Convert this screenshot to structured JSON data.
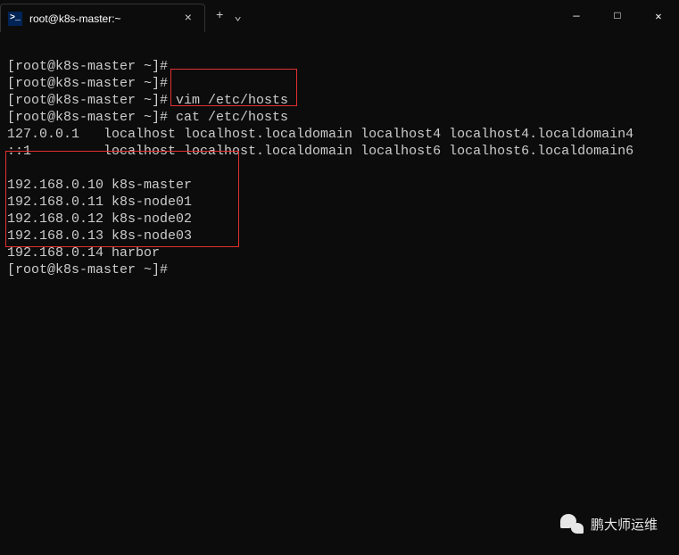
{
  "titlebar": {
    "tab": {
      "icon_label": ">_",
      "title": "root@k8s-master:~",
      "close": "×"
    },
    "actions": {
      "new_tab": "+",
      "dropdown": "⌄"
    },
    "window": {
      "minimize": "—",
      "maximize": "□",
      "close": "✕"
    }
  },
  "terminal": {
    "lines": [
      {
        "prompt": "[root@k8s-master ~]#",
        "cmd": ""
      },
      {
        "prompt": "[root@k8s-master ~]#",
        "cmd": ""
      },
      {
        "prompt": "[root@k8s-master ~]#",
        "cmd": " vim /etc/hosts"
      },
      {
        "prompt": "[root@k8s-master ~]#",
        "cmd": " cat /etc/hosts"
      }
    ],
    "output": [
      "127.0.0.1   localhost localhost.localdomain localhost4 localhost4.localdomain4",
      "::1         localhost localhost.localdomain localhost6 localhost6.localdomain6",
      "",
      "192.168.0.10 k8s-master",
      "192.168.0.11 k8s-node01",
      "192.168.0.12 k8s-node02",
      "192.168.0.13 k8s-node03",
      "192.168.0.14 harbor"
    ],
    "final_prompt": "[root@k8s-master ~]#"
  },
  "watermark": {
    "text": "鹏大师运维"
  }
}
